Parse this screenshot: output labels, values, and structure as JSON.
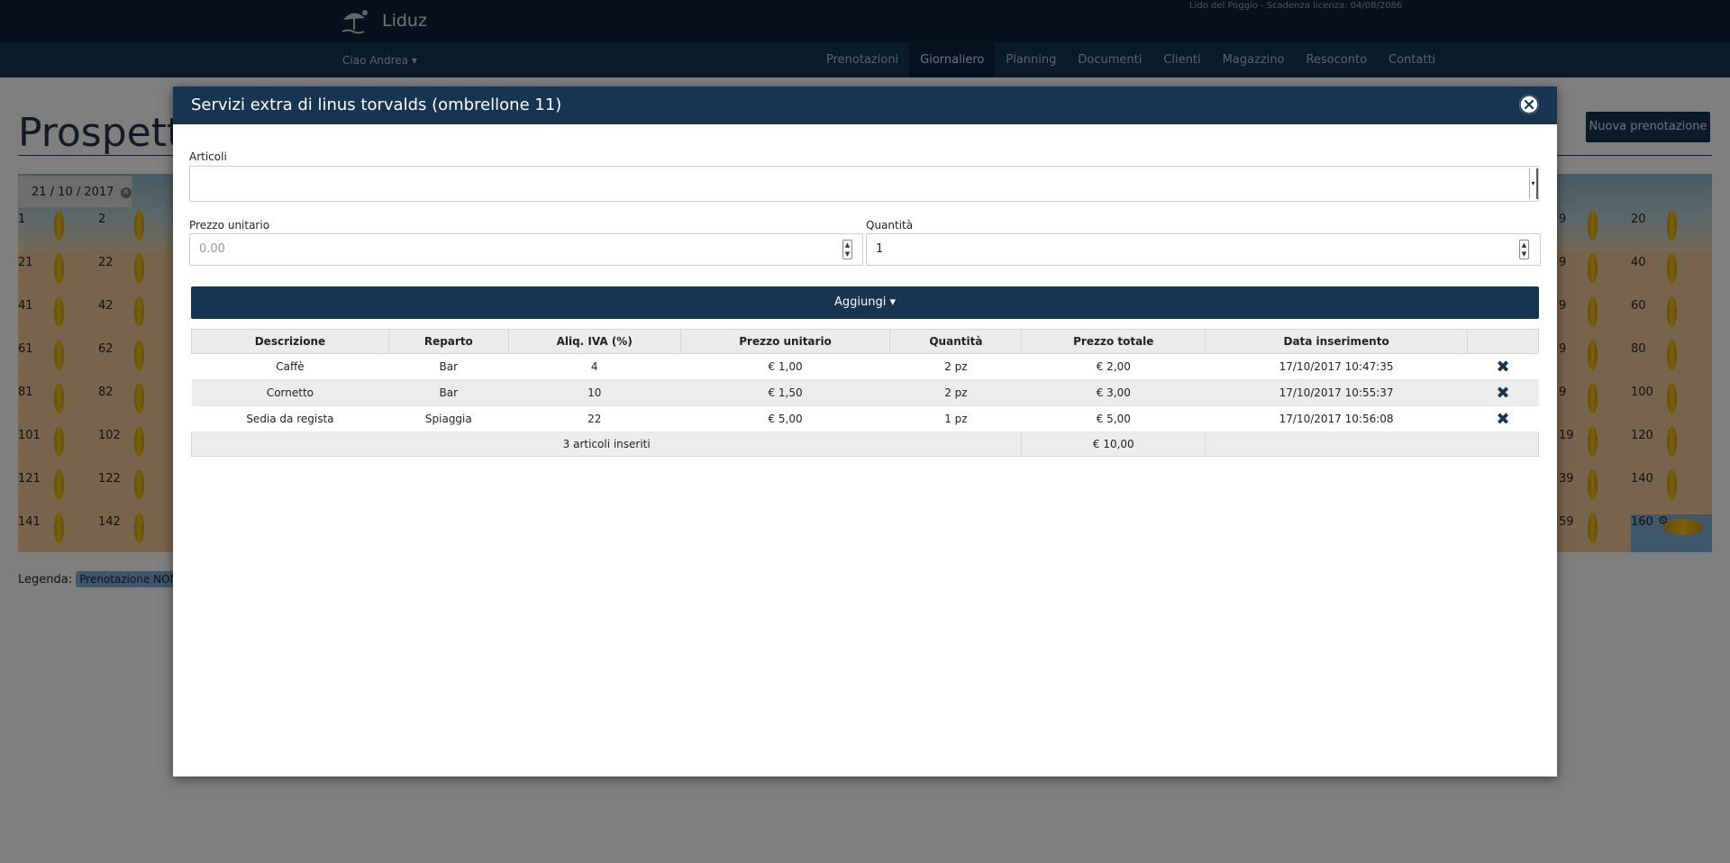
{
  "app": {
    "brand": "Liduz",
    "license": "Lido del Poggio - Scadenza licenza: 04/08/2086",
    "user_menu": "Ciao Andrea ▾"
  },
  "nav": [
    {
      "label": "Prenotazioni"
    },
    {
      "label": "Giornaliero",
      "active": true
    },
    {
      "label": "Planning"
    },
    {
      "label": "Documenti"
    },
    {
      "label": "Clienti"
    },
    {
      "label": "Magazzino"
    },
    {
      "label": "Resoconto"
    },
    {
      "label": "Contatti"
    }
  ],
  "page": {
    "title_visible": "Prospetto",
    "new_booking": "Nuova prenotazione",
    "date": "21 / 10 / 2017",
    "legend_label": "Legenda:",
    "legend_badge": "Prenotazione NON",
    "selected_umbrella": "160",
    "row_left_numbers": [
      [
        "1",
        "2"
      ],
      [
        "21",
        "22"
      ],
      [
        "41",
        "42"
      ],
      [
        "61",
        "62"
      ],
      [
        "81",
        "82"
      ],
      [
        "101",
        "102"
      ],
      [
        "121",
        "122"
      ],
      [
        "141",
        "142"
      ]
    ],
    "row_right_partial": [
      "9",
      "9",
      "9",
      "9",
      "9",
      "19",
      "39",
      "59"
    ],
    "row_right_numbers": [
      "20",
      "40",
      "60",
      "80",
      "100",
      "120",
      "140",
      "160"
    ],
    "umbrella_colors": {
      "gold": "#f5c31c",
      "selected": "#7eaed6"
    }
  },
  "modal": {
    "title": "Servizi extra di linus torvalds (ombrellone 11)",
    "articoli_label": "Articoli",
    "articoli_value": "",
    "prezzo_label": "Prezzo unitario",
    "prezzo_placeholder": "0.00",
    "quantita_label": "Quantità",
    "quantita_value": "1",
    "add_button": "Aggiungi ▾",
    "columns": [
      "Descrizione",
      "Reparto",
      "Aliq. IVA (%)",
      "Prezzo unitario",
      "Quantità",
      "Prezzo totale",
      "Data inserimento",
      ""
    ],
    "rows": [
      {
        "descrizione": "Caffè",
        "reparto": "Bar",
        "iva": "4",
        "prezzo_unitario": "€ 1,00",
        "quantita": "2 pz",
        "prezzo_totale": "€ 2,00",
        "data": "17/10/2017 10:47:35"
      },
      {
        "descrizione": "Cornetto",
        "reparto": "Bar",
        "iva": "10",
        "prezzo_unitario": "€ 1,50",
        "quantita": "2 pz",
        "prezzo_totale": "€ 3,00",
        "data": "17/10/2017 10:55:37"
      },
      {
        "descrizione": "Sedia da regista",
        "reparto": "Spiaggia",
        "iva": "22",
        "prezzo_unitario": "€ 5,00",
        "quantita": "1 pz",
        "prezzo_totale": "€ 5,00",
        "data": "17/10/2017 10:56:08"
      }
    ],
    "footer": {
      "count": "3 articoli inseriti",
      "total": "€ 10,00"
    },
    "delete_icon": "✖",
    "accent_color": "#173452"
  }
}
